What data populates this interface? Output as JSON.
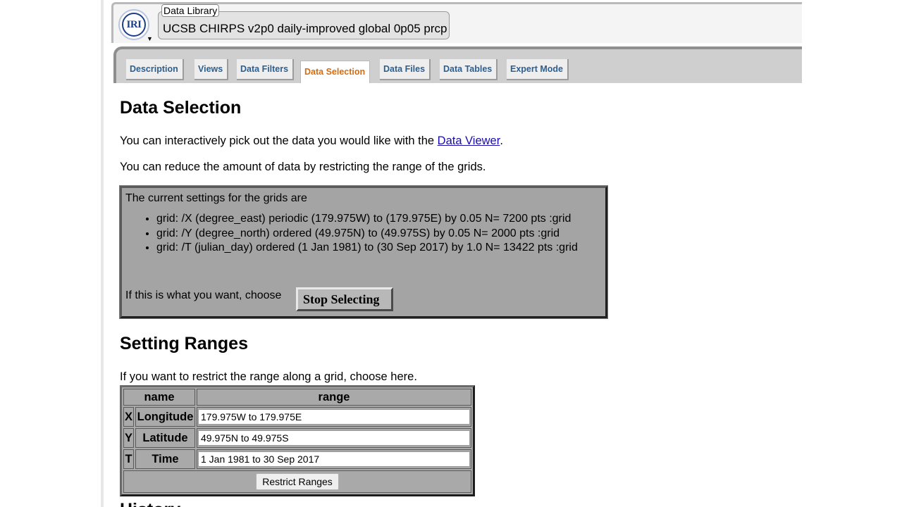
{
  "header": {
    "logo_text": "IRI",
    "library_label": "Data Library",
    "dataset_title": "UCSB CHIRPS v2p0 daily-improved global 0p05 prcp"
  },
  "tabs": [
    {
      "label": "Description"
    },
    {
      "label": "Views"
    },
    {
      "label": "Data Filters"
    },
    {
      "label": "Data Selection",
      "active": true
    },
    {
      "label": "Data Files"
    },
    {
      "label": "Data Tables"
    },
    {
      "label": "Expert Mode"
    }
  ],
  "main": {
    "heading": "Data Selection",
    "viewer_text_before": "You can interactively pick out the data you would like with the ",
    "viewer_link": "Data Viewer",
    "viewer_text_after": ".",
    "reduce_text": "You can reduce the amount of data by restricting the range of the grids.",
    "settings": {
      "intro": "The current settings for the grids are",
      "grids": [
        "grid: /X (degree_east) periodic (179.975W) to (179.975E) by 0.05 N= 7200 pts :grid",
        "grid: /Y (degree_north) ordered (49.975N) to (49.975S) by 0.05 N= 2000 pts :grid",
        "grid: /T (julian_day) ordered (1 Jan 1981) to (30 Sep 2017) by 1.0 N= 13422 pts :grid"
      ],
      "choose_text": "If this is what you want, choose",
      "stop_button": "Stop Selecting"
    },
    "ranges": {
      "heading": "Setting Ranges",
      "instruction": "If you want to restrict the range along a grid, choose here.",
      "col_name": "name",
      "col_range": "range",
      "rows": [
        {
          "axis": "X",
          "name": "Longitude",
          "value": "179.975W to 179.975E"
        },
        {
          "axis": "Y",
          "name": "Latitude",
          "value": "49.975N to 49.975S"
        },
        {
          "axis": "T",
          "name": "Time",
          "value": "1 Jan 1981 to 30 Sep 2017"
        }
      ],
      "restrict_button": "Restrict Ranges"
    },
    "next_heading": "History"
  }
}
